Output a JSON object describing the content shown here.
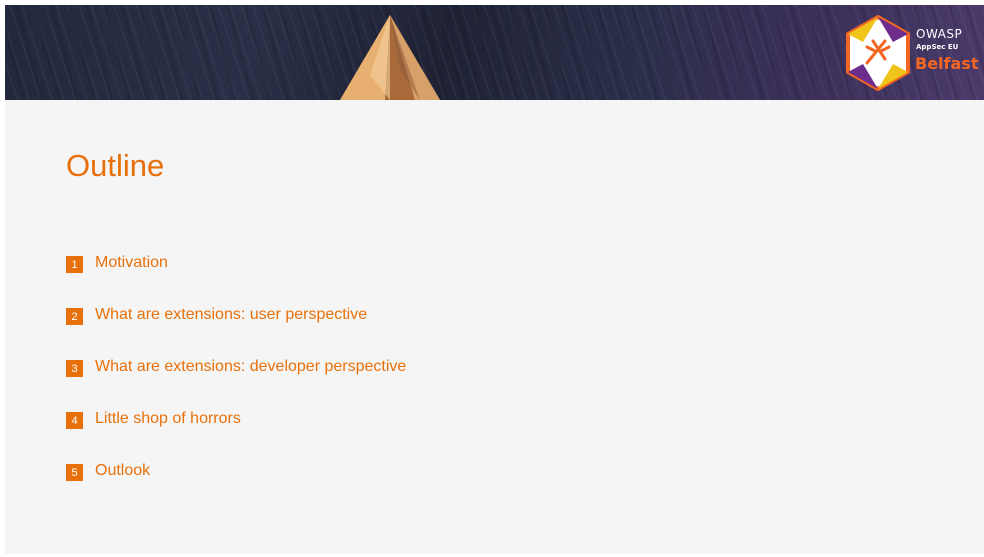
{
  "banner": {
    "logo": {
      "owasp": "OWASP",
      "appsec": "AppSec EU",
      "city": "Belfast"
    }
  },
  "slide": {
    "title": "Outline",
    "items": [
      {
        "number": "1",
        "label": "Motivation"
      },
      {
        "number": "2",
        "label": "What are extensions: user perspective"
      },
      {
        "number": "3",
        "label": "What are extensions: developer perspective"
      },
      {
        "number": "4",
        "label": "Little shop of horrors"
      },
      {
        "number": "5",
        "label": "Outlook"
      }
    ]
  },
  "colors": {
    "accent": "#e8700a",
    "belfast": "#f26522",
    "background": "#f5f5f5",
    "banner": "#23283c"
  }
}
